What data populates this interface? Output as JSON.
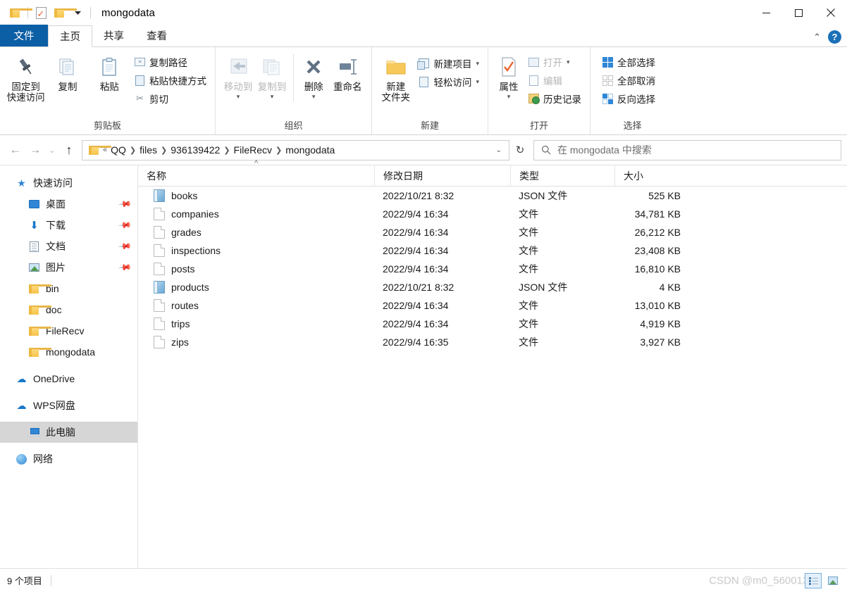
{
  "window": {
    "title": "mongodata",
    "quick_access": [
      {
        "name": "folder-icon",
        "label": "folder"
      },
      {
        "name": "properties-icon",
        "label": "properties"
      },
      {
        "name": "new-folder-icon",
        "label": "new folder"
      }
    ],
    "controls": {
      "minimize": "minimize",
      "maximize": "maximize",
      "close": "close"
    }
  },
  "tabs": [
    {
      "label": "文件",
      "key": "file"
    },
    {
      "label": "主页",
      "key": "home"
    },
    {
      "label": "共享",
      "key": "share"
    },
    {
      "label": "查看",
      "key": "view"
    }
  ],
  "ribbon": {
    "collapse_label": "^",
    "help_label": "?",
    "groups": [
      {
        "label": "剪贴板",
        "big": [
          {
            "label": "固定到\n快速访问",
            "line1": "固定到",
            "line2": "快速访问",
            "icon": "pin-icon",
            "disabled": false
          },
          {
            "label": "复制",
            "line1": "复制",
            "line2": "",
            "icon": "copy-icon",
            "disabled": false
          },
          {
            "label": "粘贴",
            "line1": "粘贴",
            "line2": "",
            "icon": "paste-icon",
            "disabled": false
          }
        ],
        "small": [
          {
            "label": "复制路径",
            "icon": "copy-path-icon",
            "disabled": false
          },
          {
            "label": "粘贴快捷方式",
            "icon": "paste-shortcut-icon",
            "disabled": false
          },
          {
            "label": "剪切",
            "icon": "cut-icon",
            "disabled": false
          }
        ]
      },
      {
        "label": "组织",
        "big": [
          {
            "line1": "移动到",
            "line2": "",
            "icon": "move-to-icon",
            "disabled": true,
            "caret": true
          },
          {
            "line1": "复制到",
            "line2": "",
            "icon": "copy-to-icon",
            "disabled": true,
            "caret": true
          },
          {
            "line1": "删除",
            "line2": "",
            "icon": "delete-icon",
            "disabled": false,
            "caret": true
          },
          {
            "line1": "重命名",
            "line2": "",
            "icon": "rename-icon",
            "disabled": false,
            "caret": false
          }
        ]
      },
      {
        "label": "新建",
        "big": [
          {
            "line1": "新建",
            "line2": "文件夹",
            "icon": "new-folder-icon",
            "disabled": false
          }
        ],
        "small": [
          {
            "label": "新建项目",
            "icon": "new-item-icon",
            "caret": true
          },
          {
            "label": "轻松访问",
            "icon": "easy-access-icon",
            "caret": true
          }
        ]
      },
      {
        "label": "打开",
        "big": [
          {
            "line1": "属性",
            "line2": "",
            "icon": "properties-icon",
            "disabled": false,
            "caret": true
          }
        ],
        "small": [
          {
            "label": "打开",
            "icon": "open-icon",
            "disabled": true,
            "caret": true
          },
          {
            "label": "编辑",
            "icon": "edit-icon",
            "disabled": true
          },
          {
            "label": "历史记录",
            "icon": "history-icon",
            "disabled": false
          }
        ]
      },
      {
        "label": "选择",
        "small": [
          {
            "label": "全部选择",
            "icon": "select-all-icon"
          },
          {
            "label": "全部取消",
            "icon": "select-none-icon"
          },
          {
            "label": "反向选择",
            "icon": "invert-selection-icon"
          }
        ]
      }
    ]
  },
  "address": {
    "back": "back-arrow",
    "forward": "forward-arrow",
    "recent": "recent-caret",
    "up": "up-arrow",
    "crumbs": [
      "QQ",
      "files",
      "936139422",
      "FileRecv",
      "mongodata"
    ],
    "leading": "«",
    "refresh": "refresh-icon"
  },
  "search": {
    "placeholder": "在 mongodata 中搜索",
    "icon": "search-icon"
  },
  "sidebar": {
    "items": [
      {
        "label": "快速访问",
        "icon": "star-icon",
        "level": 0,
        "pinned": false,
        "selected": false
      },
      {
        "label": "桌面",
        "icon": "desktop-icon",
        "level": 1,
        "pinned": true,
        "selected": false
      },
      {
        "label": "下载",
        "icon": "download-icon",
        "level": 1,
        "pinned": true,
        "selected": false
      },
      {
        "label": "文档",
        "icon": "documents-icon",
        "level": 1,
        "pinned": true,
        "selected": false
      },
      {
        "label": "图片",
        "icon": "pictures-icon",
        "level": 1,
        "pinned": true,
        "selected": false
      },
      {
        "label": "bin",
        "icon": "folder-icon",
        "level": 1,
        "pinned": false,
        "selected": false
      },
      {
        "label": "doc",
        "icon": "folder-icon",
        "level": 1,
        "pinned": false,
        "selected": false
      },
      {
        "label": "FileRecv",
        "icon": "folder-icon",
        "level": 1,
        "pinned": false,
        "selected": false
      },
      {
        "label": "mongodata",
        "icon": "folder-icon",
        "level": 1,
        "pinned": false,
        "selected": false
      },
      {
        "label": "OneDrive",
        "icon": "cloud-icon",
        "level": 0,
        "pinned": false,
        "selected": false
      },
      {
        "label": "WPS网盘",
        "icon": "cloud-icon",
        "level": 0,
        "pinned": false,
        "selected": false
      },
      {
        "label": "此电脑",
        "icon": "this-pc-icon",
        "level": 0,
        "pinned": false,
        "selected": true
      },
      {
        "label": "网络",
        "icon": "network-icon",
        "level": 0,
        "pinned": false,
        "selected": false
      }
    ]
  },
  "filelist": {
    "columns": [
      "名称",
      "修改日期",
      "类型",
      "大小"
    ],
    "sort": {
      "column": "名称",
      "direction": "asc",
      "glyph": "^"
    },
    "rows": [
      {
        "name": "books",
        "date": "2022/10/21 8:32",
        "type": "JSON 文件",
        "size": "525 KB",
        "icon": "json-file-icon"
      },
      {
        "name": "companies",
        "date": "2022/9/4 16:34",
        "type": "文件",
        "size": "34,781 KB",
        "icon": "generic-file-icon"
      },
      {
        "name": "grades",
        "date": "2022/9/4 16:34",
        "type": "文件",
        "size": "26,212 KB",
        "icon": "generic-file-icon"
      },
      {
        "name": "inspections",
        "date": "2022/9/4 16:34",
        "type": "文件",
        "size": "23,408 KB",
        "icon": "generic-file-icon"
      },
      {
        "name": "posts",
        "date": "2022/9/4 16:34",
        "type": "文件",
        "size": "16,810 KB",
        "icon": "generic-file-icon"
      },
      {
        "name": "products",
        "date": "2022/10/21 8:32",
        "type": "JSON 文件",
        "size": "4 KB",
        "icon": "json-file-icon"
      },
      {
        "name": "routes",
        "date": "2022/9/4 16:34",
        "type": "文件",
        "size": "13,010 KB",
        "icon": "generic-file-icon"
      },
      {
        "name": "trips",
        "date": "2022/9/4 16:34",
        "type": "文件",
        "size": "4,919 KB",
        "icon": "generic-file-icon"
      },
      {
        "name": "zips",
        "date": "2022/9/4 16:35",
        "type": "文件",
        "size": "3,927 KB",
        "icon": "generic-file-icon"
      }
    ]
  },
  "statusbar": {
    "item_count": "9 个项目",
    "watermark": "CSDN @m0_56001360",
    "views": [
      {
        "name": "details-view",
        "active": true
      },
      {
        "name": "large-icons-view",
        "active": false
      }
    ]
  },
  "colors": {
    "file_tab_blue": "#0c5fa5",
    "accent_blue": "#2f86d6",
    "selected_row": "#d6d6d6",
    "help_blue": "#1b71b8"
  }
}
